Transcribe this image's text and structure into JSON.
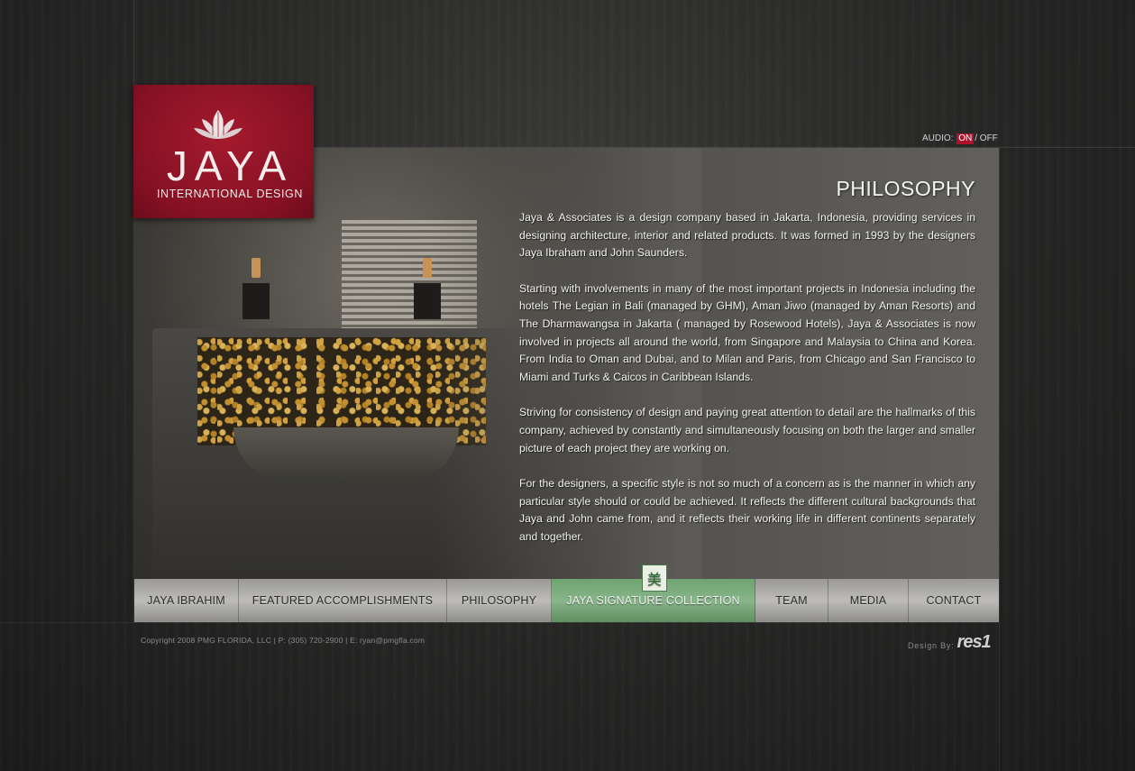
{
  "logo": {
    "name": "JAYA",
    "subtitle": "INTERNATIONAL DESIGN"
  },
  "audio": {
    "label": "AUDIO:",
    "on": "ON",
    "separator": "/",
    "off": "OFF"
  },
  "main": {
    "heading": "PHILOSOPHY",
    "paragraphs": [
      "Jaya & Associates is a design company based in Jakarta, Indonesia, providing services in designing architecture, interior and related products. It was formed in 1993 by the designers Jaya Ibraham and John Saunders.",
      "Starting with involvements in many of the most important projects in Indonesia including the hotels The Legian in Bali (managed by GHM), Aman Jiwo (managed by Aman Resorts) and The Dharmawangsa in Jakarta ( managed by Rosewood Hotels), Jaya & Associates is now involved in projects all around the world, from Singapore and Malaysia to China and Korea. From India to Oman and Dubai, and to Milan and Paris, from Chicago and San Francisco to Miami and Turks & Caicos in Caribbean Islands.",
      "Striving for consistency of design and paying great attention to detail are the hallmarks of this company, achieved by constantly and simultaneously focusing on both the larger and smaller picture of each project they are working on.",
      "For the designers, a specific style is not so much of a concern as is the manner in which any particular style should or could be achieved. It reflects the different cultural backgrounds that Jaya and John came from, and it reflects their working life in different continents separately and together."
    ]
  },
  "nav": {
    "items": [
      {
        "label": "JAYA IBRAHIM"
      },
      {
        "label": "FEATURED ACCOMPLISHMENTS"
      },
      {
        "label": "PHILOSOPHY"
      },
      {
        "label": "JAYA SIGNATURE COLLECTION"
      },
      {
        "label": "TEAM"
      },
      {
        "label": "MEDIA"
      },
      {
        "label": "CONTACT"
      }
    ],
    "active_index": 3,
    "badge_glyph": "美"
  },
  "footer": {
    "copyright": "Copyright 2008 PMG FLORIDA, LLC | P: (305) 720-2900 | E: ryan@pmgfla.com",
    "design_by_label": "Design By:",
    "design_by_logo": "res1"
  },
  "colors": {
    "logo_red": "#861124",
    "audio_on_red": "#b1122b",
    "nav_active_green": "#88b58a",
    "nav_gray": "#bdbcb8"
  }
}
